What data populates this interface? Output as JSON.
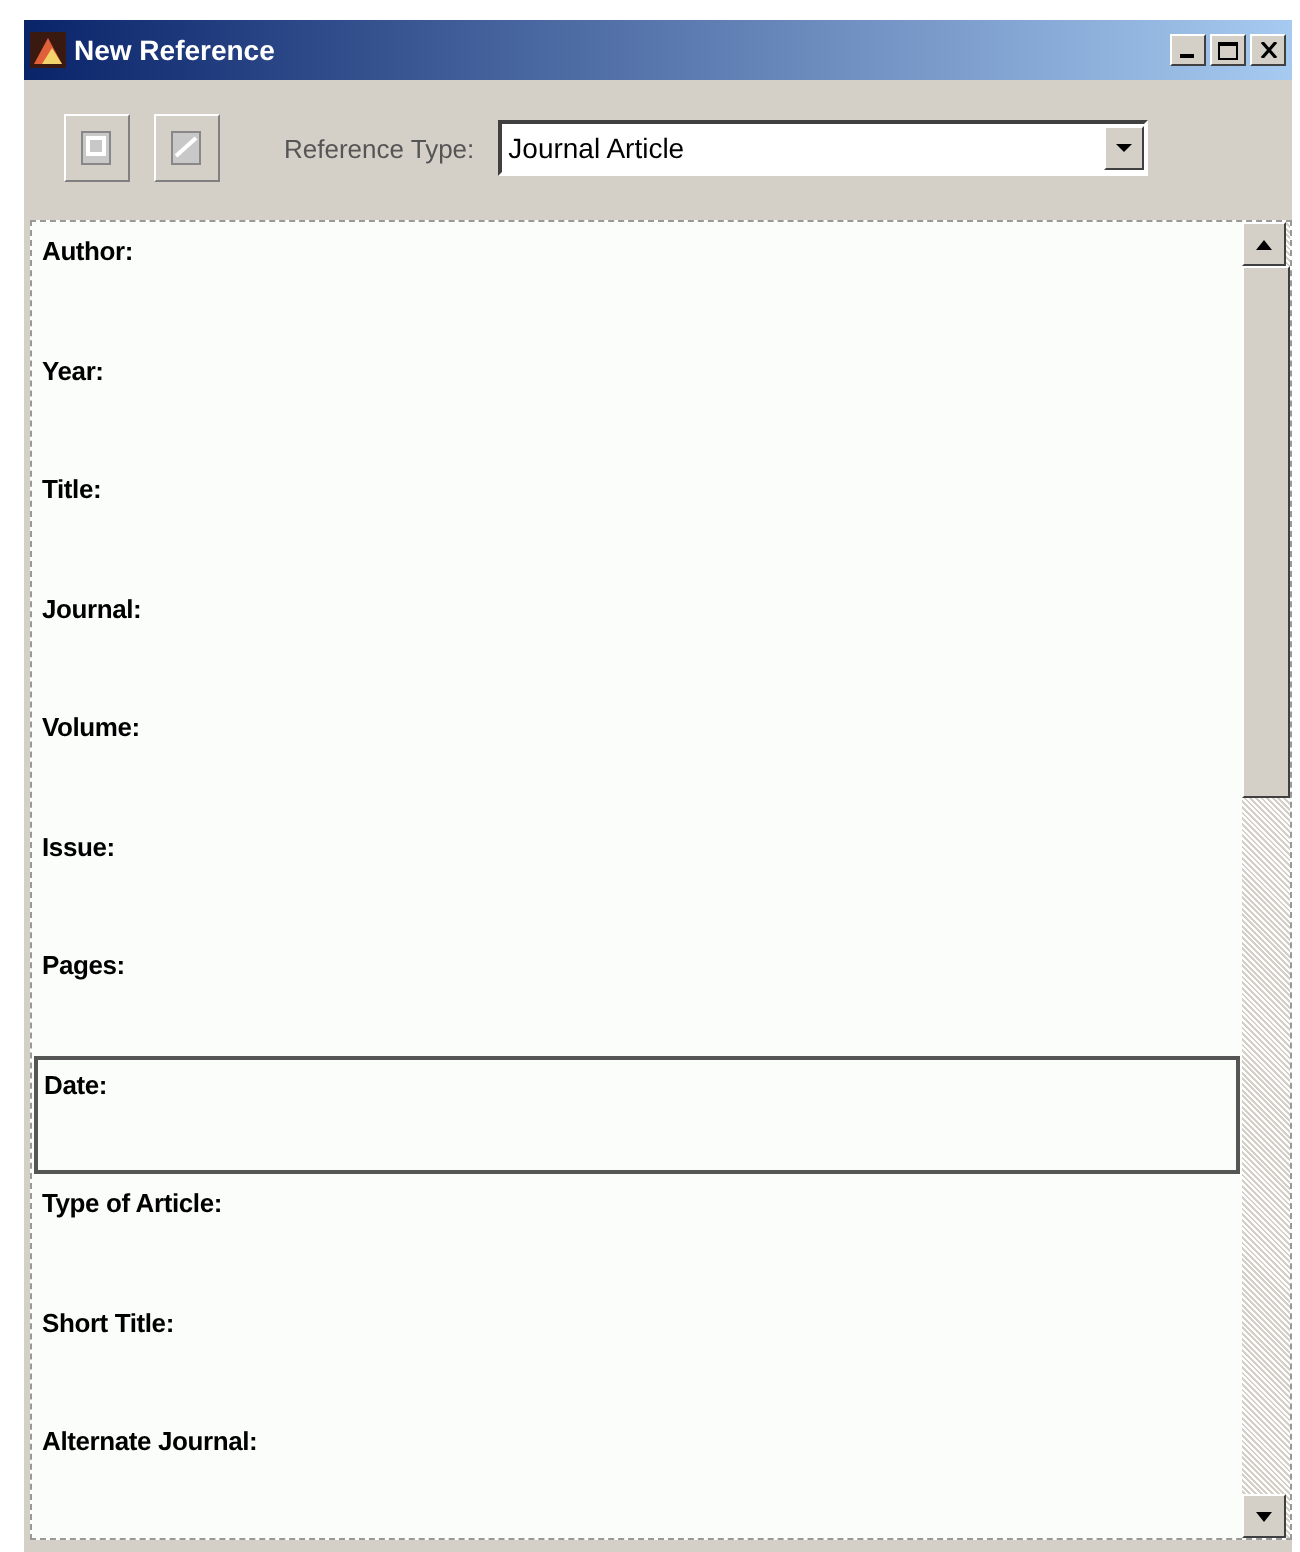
{
  "window": {
    "title": "New Reference"
  },
  "toolbar": {
    "reference_type_label": "Reference Type:",
    "reference_type": "Journal Article"
  },
  "fields": [
    {
      "label": "Author:",
      "focused": false
    },
    {
      "label": "Year:",
      "focused": false
    },
    {
      "label": "Title:",
      "focused": false
    },
    {
      "label": "Journal:",
      "focused": false
    },
    {
      "label": "Volume:",
      "focused": false
    },
    {
      "label": "Issue:",
      "focused": false
    },
    {
      "label": "Pages:",
      "focused": false
    },
    {
      "label": "Date:",
      "focused": true
    },
    {
      "label": "Type of Article:",
      "focused": false
    },
    {
      "label": "Short Title:",
      "focused": false
    },
    {
      "label": "Alternate Journal:",
      "focused": false
    }
  ]
}
